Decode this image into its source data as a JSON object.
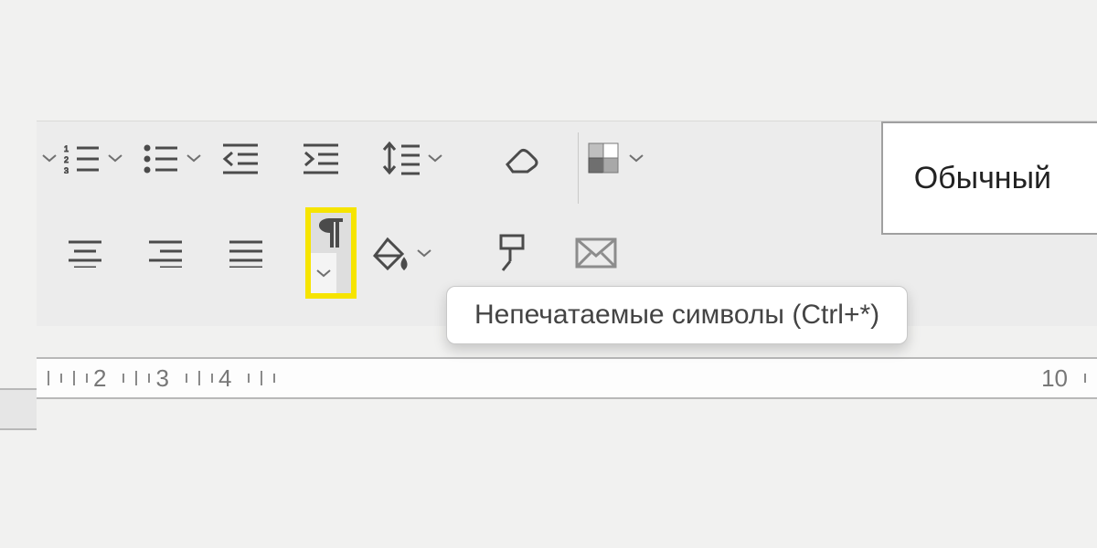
{
  "style_box_label": "Обычный",
  "tooltip_text": "Непечатаемые символы (Ctrl+*)",
  "ruler_numbers": [
    "2",
    "3",
    "4",
    "10"
  ],
  "icons": {
    "chevron": "chevron-down",
    "numbered_list": "numbered-list",
    "bulleted": "bulleted-list",
    "dec_indent": "decrease-indent",
    "inc_indent": "increase-indent",
    "line_spacing": "line-spacing",
    "eraser": "clear-formatting",
    "color_cells": "color-theme",
    "align_center": "align-center",
    "align_right": "align-right",
    "justify": "justify",
    "pilcrow": "show-formatting-marks",
    "paint_bucket": "fill-color",
    "clone": "clone-formatting",
    "envelope": "envelope"
  }
}
